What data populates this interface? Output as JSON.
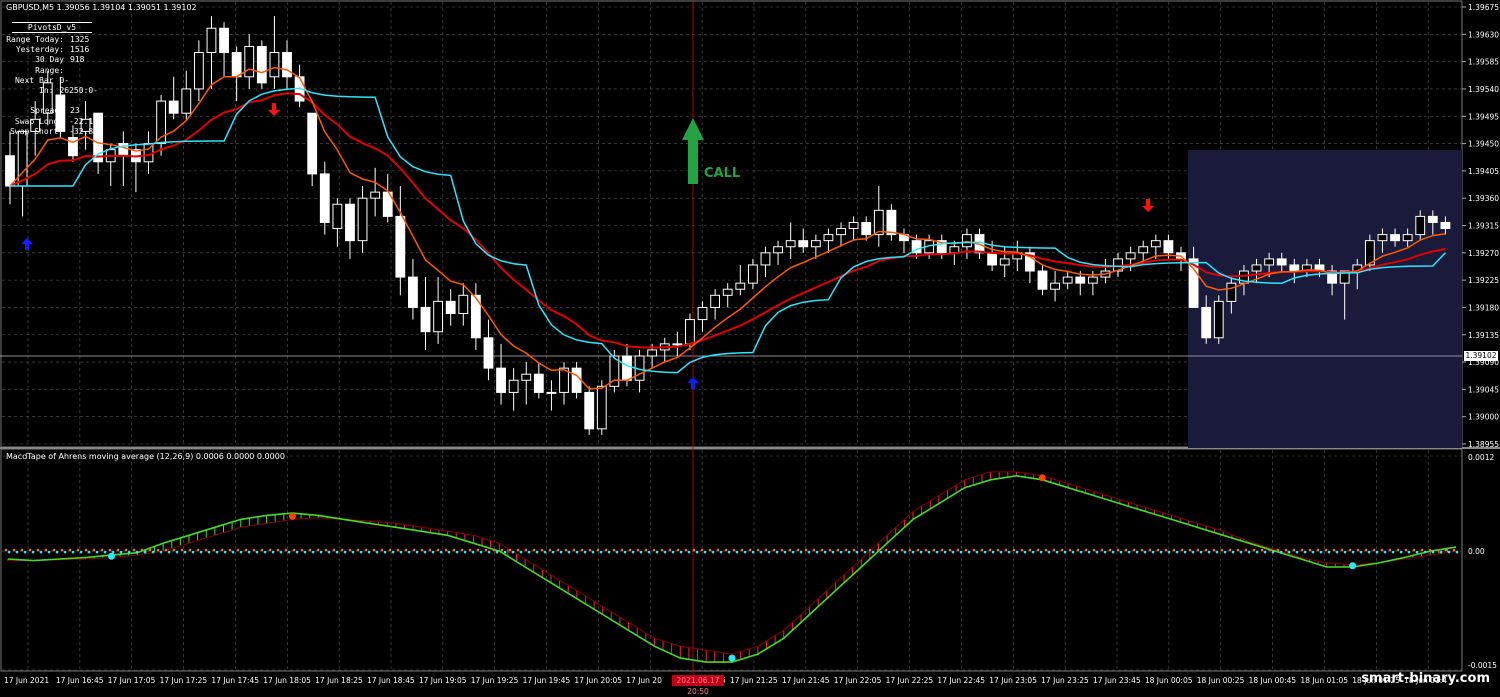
{
  "symbol_line": "GBPUSD,M5  1.39056 1.39104 1.39051 1.39102",
  "info_panel": {
    "title": "PivotsD_v5",
    "rows": [
      {
        "label": "Range Today:",
        "value": "1325"
      },
      {
        "label": "Yesterday:",
        "value": "1516"
      },
      {
        "label": "30 Day Range:",
        "value": "918"
      },
      {
        "label": "Next Bar In:",
        "value": "0-26250:0-2"
      },
      {
        "label": "Spread:",
        "value": "23"
      },
      {
        "label": "Swap Long:",
        "value": "-22.12"
      },
      {
        "label": "Swap Short:",
        "value": "-32.80"
      }
    ]
  },
  "indicator_title": "MacdTape of Ahrens moving average (12,26,9) 0.0006 0.0000 0.0000",
  "call_label": "CALL",
  "watermark": "smart-binary.com",
  "current_price_tag": "1.39102",
  "date_tag": "2021.06.17 20:50",
  "colors": {
    "background": "#000000",
    "grid": "#5a5a5a",
    "bull_candle": "#ffffff",
    "bear_candle": "#ffffff",
    "ma_fast": "#ff5a00",
    "ma_red": "#e00000",
    "ma_cyan": "#2ee6ff",
    "call_arrow": "#25a243",
    "up_arrow": "#1a1aff",
    "down_arrow": "#ff1010",
    "macd_up": "#44dd22",
    "macd_down": "#ff2050",
    "shaded_zone": "#1a1a3a",
    "vline": "#b00000"
  },
  "chart_data": [
    {
      "type": "candlestick",
      "title": "GBPUSD,M5",
      "price_axis_ticks": [
        "1.39675",
        "1.39630",
        "1.39585",
        "1.39540",
        "1.39495",
        "1.39450",
        "1.39405",
        "1.39360",
        "1.39315",
        "1.39270",
        "1.39225",
        "1.39180",
        "1.39135",
        "1.39090",
        "1.39045",
        "1.39000",
        "1.38955"
      ],
      "time_axis_ticks": [
        "17 Jun 2021",
        "17 Jun 16:45",
        "17 Jun 17:05",
        "17 Jun 17:25",
        "17 Jun 17:45",
        "17 Jun 18:05",
        "17 Jun 18:25",
        "17 Jun 18:45",
        "17 Jun 19:05",
        "17 Jun 19:25",
        "17 Jun 19:45",
        "17 Jun 20:05",
        "17 Jun 20",
        "17 Jun 21:05",
        "17 Jun 21:25",
        "17 Jun 21:45",
        "17 Jun 22:05",
        "17 Jun 22:25",
        "17 Jun 22:45",
        "17 Jun 23:05",
        "17 Jun 23:25",
        "17 Jun 23:45",
        "18 Jun 00:05",
        "18 Jun 00:25",
        "18 Jun 00:45",
        "18 Jun 01:05",
        "18 Jun 01:25",
        "18 Jun 01:4"
      ],
      "ylim": [
        1.38955,
        1.39675
      ],
      "candles": [
        [
          1.3943,
          1.3947,
          1.3935,
          1.3938
        ],
        [
          1.3938,
          1.3947,
          1.3933,
          1.3947
        ],
        [
          1.3947,
          1.3952,
          1.3943,
          1.3949
        ],
        [
          1.395,
          1.3957,
          1.3948,
          1.3955
        ],
        [
          1.3953,
          1.3956,
          1.3946,
          1.3947
        ],
        [
          1.3946,
          1.3948,
          1.3942,
          1.3943
        ],
        [
          1.3947,
          1.3952,
          1.3944,
          1.3949
        ],
        [
          1.395,
          1.395,
          1.394,
          1.3942
        ],
        [
          1.3942,
          1.3945,
          1.3938,
          1.3944
        ],
        [
          1.3945,
          1.3947,
          1.3938,
          1.3943
        ],
        [
          1.3944,
          1.3945,
          1.3937,
          1.3942
        ],
        [
          1.3942,
          1.3947,
          1.394,
          1.3945
        ],
        [
          1.3945,
          1.3953,
          1.3943,
          1.3952
        ],
        [
          1.3952,
          1.3956,
          1.3949,
          1.395
        ],
        [
          1.395,
          1.3957,
          1.3949,
          1.3954
        ],
        [
          1.3954,
          1.3962,
          1.3952,
          1.396
        ],
        [
          1.396,
          1.3966,
          1.3954,
          1.3964
        ],
        [
          1.3964,
          1.3965,
          1.3956,
          1.396
        ],
        [
          1.396,
          1.3961,
          1.3952,
          1.3956
        ],
        [
          1.3956,
          1.3963,
          1.3954,
          1.3961
        ],
        [
          1.3961,
          1.3962,
          1.3954,
          1.3955
        ],
        [
          1.3956,
          1.3966,
          1.3954,
          1.396
        ],
        [
          1.396,
          1.3962,
          1.3954,
          1.3956
        ],
        [
          1.3956,
          1.3958,
          1.3951,
          1.3952
        ],
        [
          1.395,
          1.395,
          1.3938,
          1.394
        ],
        [
          1.394,
          1.3942,
          1.393,
          1.3932
        ],
        [
          1.3931,
          1.3936,
          1.3928,
          1.3935
        ],
        [
          1.3935,
          1.3936,
          1.3926,
          1.3929
        ],
        [
          1.3929,
          1.3938,
          1.3927,
          1.3936
        ],
        [
          1.3936,
          1.3941,
          1.3933,
          1.3937
        ],
        [
          1.3937,
          1.394,
          1.3932,
          1.3933
        ],
        [
          1.3933,
          1.3938,
          1.392,
          1.3923
        ],
        [
          1.3923,
          1.3926,
          1.3916,
          1.3918
        ],
        [
          1.3918,
          1.3923,
          1.3911,
          1.3914
        ],
        [
          1.3914,
          1.3923,
          1.3912,
          1.3919
        ],
        [
          1.3919,
          1.3921,
          1.3915,
          1.3917
        ],
        [
          1.3917,
          1.3922,
          1.3915,
          1.392
        ],
        [
          1.392,
          1.3922,
          1.3911,
          1.3913
        ],
        [
          1.3913,
          1.3916,
          1.3906,
          1.3908
        ],
        [
          1.3908,
          1.3912,
          1.3902,
          1.3904
        ],
        [
          1.3904,
          1.3908,
          1.3901,
          1.3906
        ],
        [
          1.3906,
          1.3909,
          1.3902,
          1.3907
        ],
        [
          1.3907,
          1.3909,
          1.3903,
          1.3904
        ],
        [
          1.3904,
          1.3906,
          1.3901,
          1.3904
        ],
        [
          1.3904,
          1.3909,
          1.3902,
          1.3908
        ],
        [
          1.3908,
          1.3909,
          1.3903,
          1.3904
        ],
        [
          1.3904,
          1.3905,
          1.3897,
          1.3898
        ],
        [
          1.3898,
          1.3906,
          1.3897,
          1.3905
        ],
        [
          1.3905,
          1.3911,
          1.3904,
          1.391
        ],
        [
          1.391,
          1.3912,
          1.3905,
          1.3906
        ],
        [
          1.3906,
          1.3911,
          1.3904,
          1.391
        ],
        [
          1.391,
          1.3912,
          1.3908,
          1.3911
        ],
        [
          1.3911,
          1.3913,
          1.3909,
          1.3912
        ],
        [
          1.3912,
          1.3914,
          1.391,
          1.3912
        ],
        [
          1.3912,
          1.3917,
          1.3911,
          1.3916
        ],
        [
          1.3916,
          1.3919,
          1.3914,
          1.3918
        ],
        [
          1.3918,
          1.3921,
          1.3916,
          1.392
        ],
        [
          1.392,
          1.3922,
          1.3918,
          1.3921
        ],
        [
          1.3921,
          1.3925,
          1.392,
          1.3922
        ],
        [
          1.3922,
          1.3926,
          1.3921,
          1.3925
        ],
        [
          1.3925,
          1.3928,
          1.3923,
          1.3927
        ],
        [
          1.3927,
          1.3929,
          1.3925,
          1.3928
        ],
        [
          1.3928,
          1.3932,
          1.3926,
          1.3929
        ],
        [
          1.3929,
          1.3931,
          1.3927,
          1.3928
        ],
        [
          1.3928,
          1.393,
          1.3926,
          1.3929
        ],
        [
          1.3929,
          1.3931,
          1.3927,
          1.393
        ],
        [
          1.393,
          1.3932,
          1.3928,
          1.3931
        ],
        [
          1.3931,
          1.3933,
          1.3929,
          1.3932
        ],
        [
          1.3932,
          1.3933,
          1.3929,
          1.393
        ],
        [
          1.393,
          1.3938,
          1.3928,
          1.3934
        ],
        [
          1.3934,
          1.3935,
          1.3929,
          1.393
        ],
        [
          1.393,
          1.3931,
          1.3927,
          1.3929
        ],
        [
          1.3929,
          1.393,
          1.3926,
          1.3927
        ],
        [
          1.3927,
          1.393,
          1.3926,
          1.3929
        ],
        [
          1.3929,
          1.393,
          1.3926,
          1.3927
        ],
        [
          1.3927,
          1.3929,
          1.3925,
          1.3928
        ],
        [
          1.3928,
          1.3931,
          1.3926,
          1.393
        ],
        [
          1.393,
          1.3931,
          1.3926,
          1.3927
        ],
        [
          1.3927,
          1.3929,
          1.3924,
          1.3925
        ],
        [
          1.3925,
          1.3928,
          1.3923,
          1.3926
        ],
        [
          1.3926,
          1.3929,
          1.3924,
          1.3927
        ],
        [
          1.3927,
          1.3928,
          1.3922,
          1.3924
        ],
        [
          1.3924,
          1.3925,
          1.392,
          1.3921
        ],
        [
          1.3921,
          1.3924,
          1.3919,
          1.3922
        ],
        [
          1.3922,
          1.3924,
          1.3921,
          1.3923
        ],
        [
          1.3923,
          1.3924,
          1.392,
          1.3922
        ],
        [
          1.3922,
          1.3924,
          1.392,
          1.3923
        ],
        [
          1.3923,
          1.3926,
          1.3922,
          1.3924
        ],
        [
          1.3924,
          1.3927,
          1.3923,
          1.3926
        ],
        [
          1.3926,
          1.3928,
          1.3924,
          1.3927
        ],
        [
          1.3927,
          1.3929,
          1.3925,
          1.3928
        ],
        [
          1.3928,
          1.393,
          1.3926,
          1.3929
        ],
        [
          1.3929,
          1.393,
          1.3926,
          1.3927
        ],
        [
          1.3927,
          1.3928,
          1.3924,
          1.3926
        ],
        [
          1.3926,
          1.3928,
          1.3919,
          1.3918
        ],
        [
          1.3918,
          1.392,
          1.3912,
          1.3913
        ],
        [
          1.3913,
          1.392,
          1.3912,
          1.3919
        ],
        [
          1.3919,
          1.3923,
          1.3917,
          1.3922
        ],
        [
          1.3922,
          1.3925,
          1.392,
          1.3924
        ],
        [
          1.3924,
          1.3926,
          1.3922,
          1.3925
        ],
        [
          1.3925,
          1.3927,
          1.3923,
          1.3926
        ],
        [
          1.3926,
          1.3927,
          1.3924,
          1.3925
        ],
        [
          1.3925,
          1.3926,
          1.3922,
          1.3924
        ],
        [
          1.3924,
          1.3926,
          1.3923,
          1.3925
        ],
        [
          1.3925,
          1.3926,
          1.3923,
          1.3924
        ],
        [
          1.3924,
          1.3925,
          1.392,
          1.3922
        ],
        [
          1.3922,
          1.3923,
          1.3916,
          1.3924
        ],
        [
          1.3924,
          1.3926,
          1.3921,
          1.3925
        ],
        [
          1.3925,
          1.393,
          1.3924,
          1.3929
        ],
        [
          1.3929,
          1.3931,
          1.3927,
          1.393
        ],
        [
          1.393,
          1.3931,
          1.3928,
          1.3929
        ],
        [
          1.3929,
          1.3931,
          1.3928,
          1.393
        ],
        [
          1.393,
          1.3934,
          1.3929,
          1.3933
        ],
        [
          1.3933,
          1.3934,
          1.393,
          1.3932
        ],
        [
          1.3932,
          1.3933,
          1.393,
          1.3931
        ]
      ]
    },
    {
      "type": "line",
      "title": "MacdTape of Ahrens moving average (12,26,9) 0.0006 0.0000 0.0000",
      "y_axis_ticks": [
        "0.0012",
        "0.00",
        "-0.0015"
      ],
      "ylim": [
        -0.0015,
        0.0012
      ],
      "series": [
        {
          "values": [
            -0.0001,
            -0.00012,
            -0.0001,
            -8e-05,
            -5e-05,
            -2e-05,
            0.0001,
            0.0002,
            0.0003,
            0.0004,
            0.00045,
            0.00048,
            0.00045,
            0.0004,
            0.00035,
            0.0003,
            0.00025,
            0.0002,
            0.0001,
            0.0,
            -0.0002,
            -0.0004,
            -0.0006,
            -0.0008,
            -0.001,
            -0.0012,
            -0.00135,
            -0.0014,
            -0.0014,
            -0.0013,
            -0.0011,
            -0.0008,
            -0.0005,
            -0.0002,
            0.0001,
            0.0004,
            0.0006,
            0.0008,
            0.0009,
            0.00095,
            0.0009,
            0.0008,
            0.0007,
            0.0006,
            0.0005,
            0.0004,
            0.0003,
            0.0002,
            0.0001,
            0.0,
            -0.0001,
            -0.0002,
            -0.0002,
            -0.00015,
            -8e-05,
            0.0,
            5e-05
          ]
        },
        {
          "values": [
            -0.00012,
            -0.00012,
            -0.00011,
            -0.0001,
            -8e-05,
            -5e-05,
            0.0,
            0.0001,
            0.0002,
            0.0003,
            0.00035,
            0.0004,
            0.00042,
            0.0004,
            0.00038,
            0.00035,
            0.0003,
            0.00025,
            0.0002,
            0.0001,
            -0.0001,
            -0.0003,
            -0.0005,
            -0.0007,
            -0.0009,
            -0.0011,
            -0.0012,
            -0.00125,
            -0.0013,
            -0.0012,
            -0.001,
            -0.0007,
            -0.0004,
            -0.0001,
            0.0002,
            0.0005,
            0.0007,
            0.0009,
            0.001,
            0.001,
            0.00095,
            0.00085,
            0.00075,
            0.00065,
            0.00055,
            0.00045,
            0.00035,
            0.00025,
            0.00012,
            2e-05,
            -8e-05,
            -0.00015,
            -0.00017,
            -0.00015,
            -0.0001,
            -5e-05,
            0.0
          ]
        }
      ]
    }
  ]
}
